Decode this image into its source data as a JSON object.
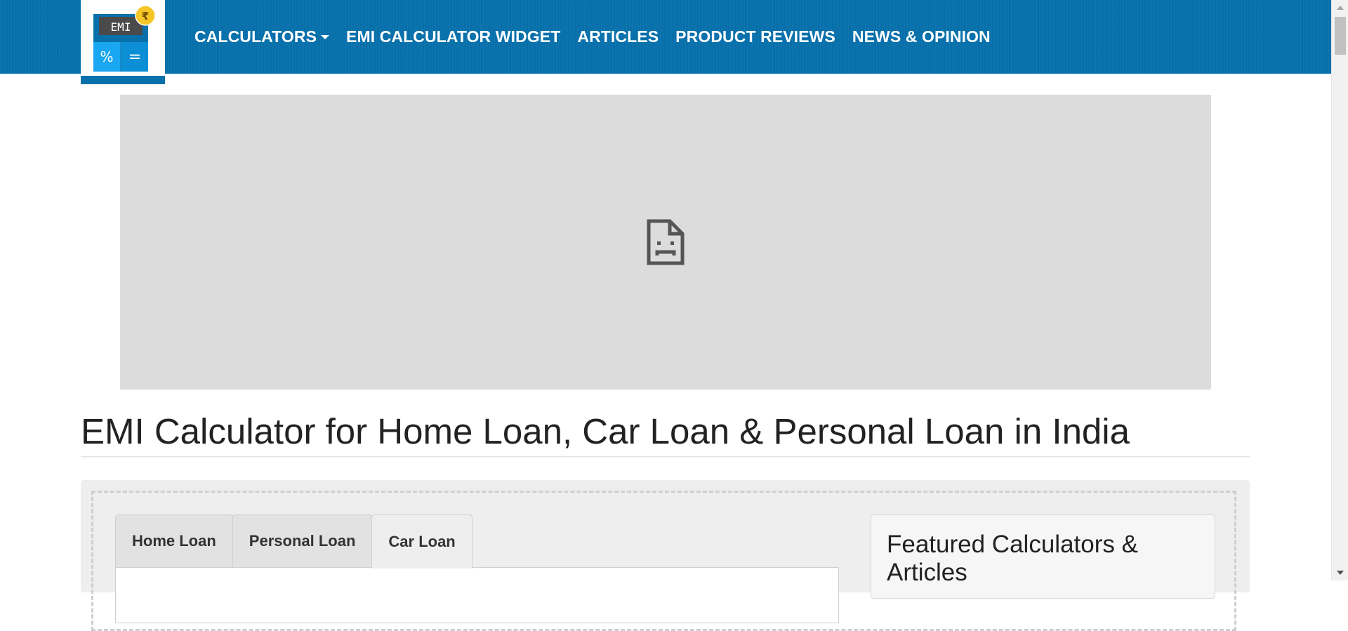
{
  "brand": {
    "logo_text": "EMI",
    "logo_symbols": {
      "currency": "₹",
      "percent": "%",
      "equals": "="
    },
    "colors": {
      "navbar": "#0870ab",
      "logo_blue": "#0aa0e8",
      "coin": "#f6c626"
    }
  },
  "nav": {
    "items": [
      {
        "label": "CALCULATORS",
        "has_dropdown": true
      },
      {
        "label": "EMI CALCULATOR WIDGET"
      },
      {
        "label": "ARTICLES"
      },
      {
        "label": "PRODUCT REVIEWS"
      },
      {
        "label": "NEWS & OPINION"
      }
    ]
  },
  "ad": {
    "icon": "broken-page-icon"
  },
  "page": {
    "title": "EMI Calculator for Home Loan, Car Loan & Personal Loan in India"
  },
  "tabs": [
    {
      "label": "Home Loan",
      "active": false
    },
    {
      "label": "Personal Loan",
      "active": false
    },
    {
      "label": "Car Loan",
      "active": true
    }
  ],
  "featured": {
    "title": "Featured Calculators & Articles"
  }
}
